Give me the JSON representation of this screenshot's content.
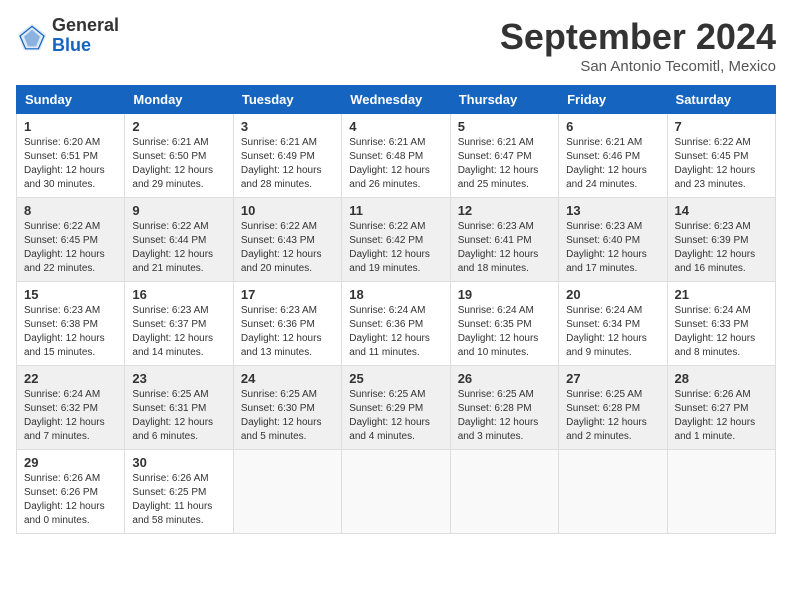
{
  "header": {
    "logo_general": "General",
    "logo_blue": "Blue",
    "month_title": "September 2024",
    "location": "San Antonio Tecomitl, Mexico"
  },
  "days_of_week": [
    "Sunday",
    "Monday",
    "Tuesday",
    "Wednesday",
    "Thursday",
    "Friday",
    "Saturday"
  ],
  "weeks": [
    {
      "bg": "row-bg-1",
      "days": [
        {
          "num": "1",
          "content": "Sunrise: 6:20 AM\nSunset: 6:51 PM\nDaylight: 12 hours\nand 30 minutes."
        },
        {
          "num": "2",
          "content": "Sunrise: 6:21 AM\nSunset: 6:50 PM\nDaylight: 12 hours\nand 29 minutes."
        },
        {
          "num": "3",
          "content": "Sunrise: 6:21 AM\nSunset: 6:49 PM\nDaylight: 12 hours\nand 28 minutes."
        },
        {
          "num": "4",
          "content": "Sunrise: 6:21 AM\nSunset: 6:48 PM\nDaylight: 12 hours\nand 26 minutes."
        },
        {
          "num": "5",
          "content": "Sunrise: 6:21 AM\nSunset: 6:47 PM\nDaylight: 12 hours\nand 25 minutes."
        },
        {
          "num": "6",
          "content": "Sunrise: 6:21 AM\nSunset: 6:46 PM\nDaylight: 12 hours\nand 24 minutes."
        },
        {
          "num": "7",
          "content": "Sunrise: 6:22 AM\nSunset: 6:45 PM\nDaylight: 12 hours\nand 23 minutes."
        }
      ]
    },
    {
      "bg": "row-bg-2",
      "days": [
        {
          "num": "8",
          "content": "Sunrise: 6:22 AM\nSunset: 6:45 PM\nDaylight: 12 hours\nand 22 minutes."
        },
        {
          "num": "9",
          "content": "Sunrise: 6:22 AM\nSunset: 6:44 PM\nDaylight: 12 hours\nand 21 minutes."
        },
        {
          "num": "10",
          "content": "Sunrise: 6:22 AM\nSunset: 6:43 PM\nDaylight: 12 hours\nand 20 minutes."
        },
        {
          "num": "11",
          "content": "Sunrise: 6:22 AM\nSunset: 6:42 PM\nDaylight: 12 hours\nand 19 minutes."
        },
        {
          "num": "12",
          "content": "Sunrise: 6:23 AM\nSunset: 6:41 PM\nDaylight: 12 hours\nand 18 minutes."
        },
        {
          "num": "13",
          "content": "Sunrise: 6:23 AM\nSunset: 6:40 PM\nDaylight: 12 hours\nand 17 minutes."
        },
        {
          "num": "14",
          "content": "Sunrise: 6:23 AM\nSunset: 6:39 PM\nDaylight: 12 hours\nand 16 minutes."
        }
      ]
    },
    {
      "bg": "row-bg-1",
      "days": [
        {
          "num": "15",
          "content": "Sunrise: 6:23 AM\nSunset: 6:38 PM\nDaylight: 12 hours\nand 15 minutes."
        },
        {
          "num": "16",
          "content": "Sunrise: 6:23 AM\nSunset: 6:37 PM\nDaylight: 12 hours\nand 14 minutes."
        },
        {
          "num": "17",
          "content": "Sunrise: 6:23 AM\nSunset: 6:36 PM\nDaylight: 12 hours\nand 13 minutes."
        },
        {
          "num": "18",
          "content": "Sunrise: 6:24 AM\nSunset: 6:36 PM\nDaylight: 12 hours\nand 11 minutes."
        },
        {
          "num": "19",
          "content": "Sunrise: 6:24 AM\nSunset: 6:35 PM\nDaylight: 12 hours\nand 10 minutes."
        },
        {
          "num": "20",
          "content": "Sunrise: 6:24 AM\nSunset: 6:34 PM\nDaylight: 12 hours\nand 9 minutes."
        },
        {
          "num": "21",
          "content": "Sunrise: 6:24 AM\nSunset: 6:33 PM\nDaylight: 12 hours\nand 8 minutes."
        }
      ]
    },
    {
      "bg": "row-bg-2",
      "days": [
        {
          "num": "22",
          "content": "Sunrise: 6:24 AM\nSunset: 6:32 PM\nDaylight: 12 hours\nand 7 minutes."
        },
        {
          "num": "23",
          "content": "Sunrise: 6:25 AM\nSunset: 6:31 PM\nDaylight: 12 hours\nand 6 minutes."
        },
        {
          "num": "24",
          "content": "Sunrise: 6:25 AM\nSunset: 6:30 PM\nDaylight: 12 hours\nand 5 minutes."
        },
        {
          "num": "25",
          "content": "Sunrise: 6:25 AM\nSunset: 6:29 PM\nDaylight: 12 hours\nand 4 minutes."
        },
        {
          "num": "26",
          "content": "Sunrise: 6:25 AM\nSunset: 6:28 PM\nDaylight: 12 hours\nand 3 minutes."
        },
        {
          "num": "27",
          "content": "Sunrise: 6:25 AM\nSunset: 6:28 PM\nDaylight: 12 hours\nand 2 minutes."
        },
        {
          "num": "28",
          "content": "Sunrise: 6:26 AM\nSunset: 6:27 PM\nDaylight: 12 hours\nand 1 minute."
        }
      ]
    },
    {
      "bg": "row-bg-1",
      "days": [
        {
          "num": "29",
          "content": "Sunrise: 6:26 AM\nSunset: 6:26 PM\nDaylight: 12 hours\nand 0 minutes."
        },
        {
          "num": "30",
          "content": "Sunrise: 6:26 AM\nSunset: 6:25 PM\nDaylight: 11 hours\nand 58 minutes."
        },
        {
          "num": "",
          "content": ""
        },
        {
          "num": "",
          "content": ""
        },
        {
          "num": "",
          "content": ""
        },
        {
          "num": "",
          "content": ""
        },
        {
          "num": "",
          "content": ""
        }
      ]
    }
  ]
}
